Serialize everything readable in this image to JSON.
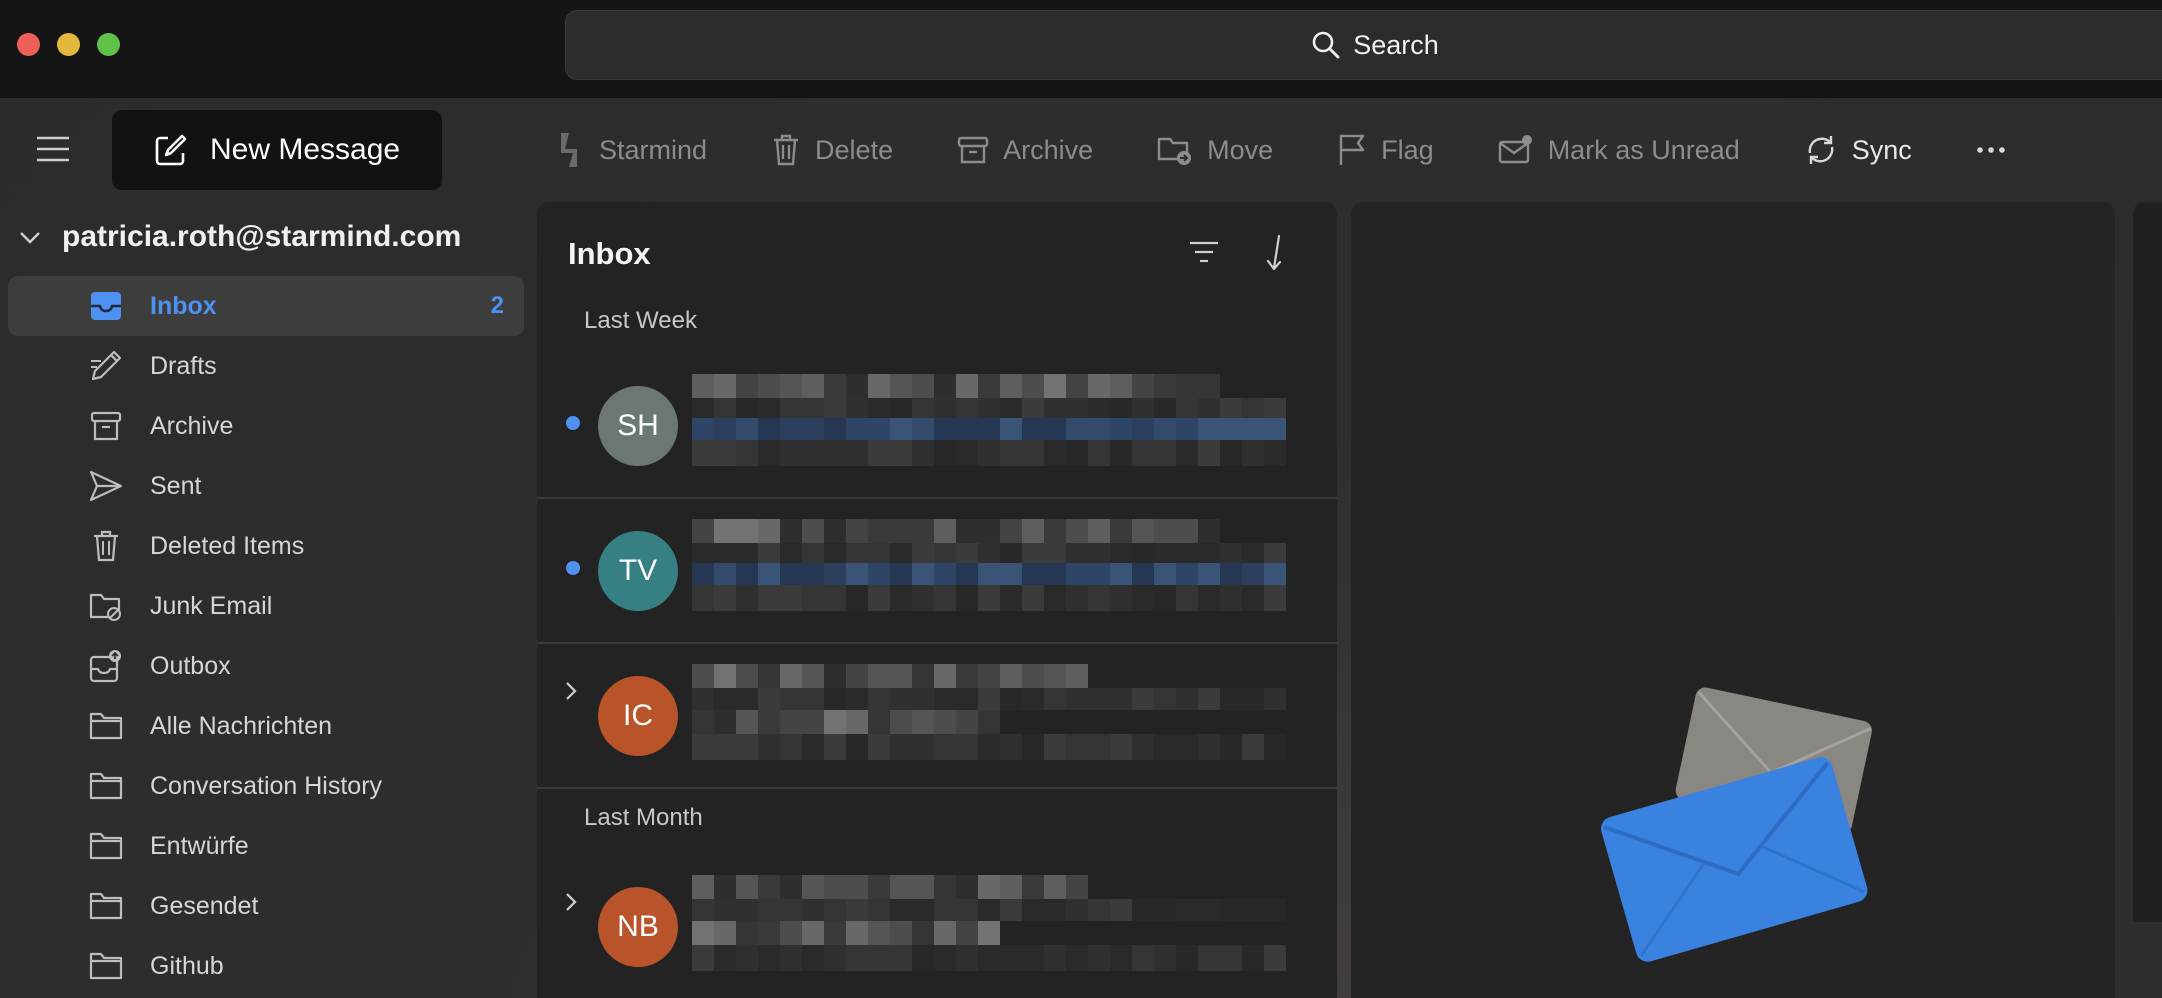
{
  "search": {
    "label": "Search"
  },
  "new_message": {
    "label": "New Message"
  },
  "toolbar": {
    "starmind": "Starmind",
    "delete": "Delete",
    "archive": "Archive",
    "move": "Move",
    "flag": "Flag",
    "mark_unread": "Mark as Unread",
    "sync": "Sync"
  },
  "account": {
    "email": "patricia.roth@starmind.com"
  },
  "folders": [
    {
      "label": "Inbox",
      "count": "2",
      "icon": "inbox-icon"
    },
    {
      "label": "Drafts",
      "icon": "pencil-icon"
    },
    {
      "label": "Archive",
      "icon": "archive-box-icon"
    },
    {
      "label": "Sent",
      "icon": "send-icon"
    },
    {
      "label": "Deleted Items",
      "icon": "trash-icon"
    },
    {
      "label": "Junk Email",
      "icon": "junk-folder-icon"
    },
    {
      "label": "Outbox",
      "icon": "outbox-icon"
    },
    {
      "label": "Alle Nachrichten",
      "icon": "folder-icon"
    },
    {
      "label": "Conversation History",
      "icon": "folder-icon"
    },
    {
      "label": "Entwürfe",
      "icon": "folder-icon"
    },
    {
      "label": "Gesendet",
      "icon": "folder-icon"
    },
    {
      "label": "Github",
      "icon": "folder-icon"
    }
  ],
  "message_list": {
    "title": "Inbox",
    "groups": [
      {
        "label": "Last Week",
        "messages": [
          {
            "initials": "SH",
            "avatar_color": "#6b7777",
            "unread": true,
            "thread": false
          },
          {
            "initials": "TV",
            "avatar_color": "#367f82",
            "unread": true,
            "thread": false
          },
          {
            "initials": "IC",
            "avatar_color": "#b8532a",
            "unread": false,
            "thread": true
          }
        ]
      },
      {
        "label": "Last Month",
        "messages": [
          {
            "initials": "NB",
            "avatar_color": "#b8532a",
            "unread": false,
            "thread": true
          }
        ]
      }
    ]
  },
  "colors": {
    "accent": "#4e91f0",
    "envelope_blue": "#3a82e0",
    "envelope_gray": "#8a8783"
  }
}
